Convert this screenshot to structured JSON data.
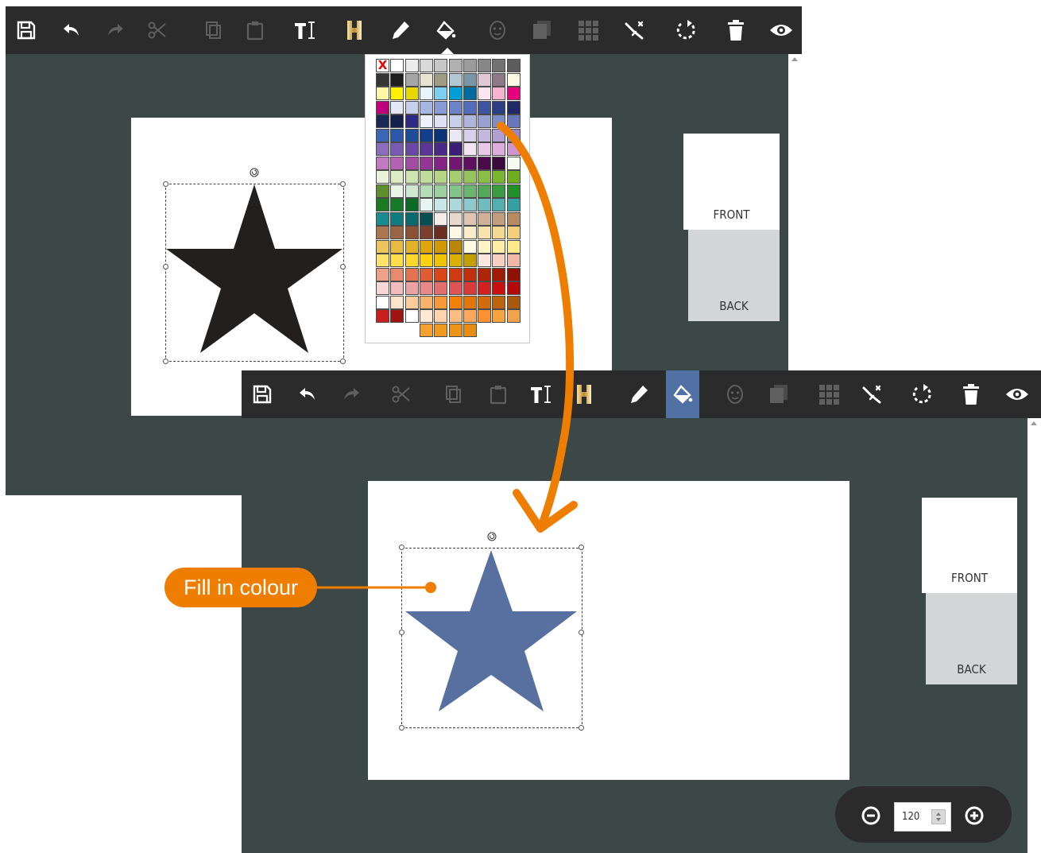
{
  "toolbar": {
    "tools": [
      {
        "name": "save-icon",
        "enabled": true
      },
      {
        "name": "undo-icon",
        "enabled": true
      },
      {
        "name": "redo-icon",
        "enabled": false
      },
      {
        "name": "cut-icon",
        "enabled": false
      },
      {
        "name": "copy-icon",
        "enabled": false
      },
      {
        "name": "paste-icon",
        "enabled": false
      },
      {
        "name": "add-text-icon",
        "enabled": true
      },
      {
        "name": "gold-foil-icon",
        "enabled": true
      },
      {
        "name": "pen-icon",
        "enabled": true
      },
      {
        "name": "fill-bucket-icon",
        "enabled": true
      },
      {
        "name": "face-mask-icon",
        "enabled": false
      },
      {
        "name": "layers-icon",
        "enabled": false
      },
      {
        "name": "grid-icon",
        "enabled": false
      },
      {
        "name": "magic-wand-icon",
        "enabled": true
      },
      {
        "name": "rotate-icon",
        "enabled": true
      },
      {
        "name": "trash-icon",
        "enabled": true
      },
      {
        "name": "preview-eye-icon",
        "enabled": true
      }
    ]
  },
  "pages": {
    "front_label": "FRONT",
    "back_label": "BACK"
  },
  "palette": {
    "no_colour_label": "X",
    "rows": [
      [
        "X",
        "#ffffff",
        "#ececec",
        "#d9d9d9",
        "#c6c6c6",
        "#b0b0b0",
        "#9b9b9b",
        "#878787",
        "#727272",
        "#5d5d5d"
      ],
      [
        "#353535",
        "#1e1e1e",
        "#a6a6a6",
        "#e8e4d0",
        "#9e9c83",
        "#b3c7d3",
        "#7a96a6",
        "#e0c8d6",
        "#8c7a86",
        "#fbf8e3"
      ],
      [
        "#fff7a8",
        "#fff200",
        "#e6d800",
        "#e8f4fc",
        "#7dcff0",
        "#00a0d7",
        "#006b9e",
        "#fde6f0",
        "#f5b3d0",
        "#e6007e"
      ],
      [
        "#c0007a",
        "#e3e8f6",
        "#c6d0ec",
        "#a7b6e0",
        "#8a9bd4",
        "#6e83c8",
        "#536cbc",
        "#3f55a0",
        "#2d3f84",
        "#1e2b68"
      ],
      [
        "#1a2a55",
        "#14214a",
        "#2e2a83",
        "#eef0fa",
        "#dfe2f4",
        "#c8cde9",
        "#aeb6de",
        "#97a2d3",
        "#7f8dc7",
        "#6678bb"
      ],
      [
        "#3a66b3",
        "#2b58a8",
        "#1f4b9a",
        "#123e8c",
        "#0b3478",
        "#ebe7f4",
        "#d8d0ea",
        "#c4b8df",
        "#af9fd3",
        "#9986c6"
      ],
      [
        "#8a6fbd",
        "#7a5bb2",
        "#6a48a5",
        "#5a3797",
        "#4a2988",
        "#3b1e77",
        "#f3e4f3",
        "#e7c9e7",
        "#dbaedb",
        "#cf93cf"
      ],
      [
        "#c27bc2",
        "#b463b4",
        "#a44ba4",
        "#943694",
        "#842484",
        "#731573",
        "#5f0f5f",
        "#4b0a4b",
        "#3a0a3a",
        "#f7fbef"
      ],
      [
        "#e9f3da",
        "#dcecc5",
        "#cfe5b0",
        "#c2dd9b",
        "#b4d585",
        "#a6cd70",
        "#98c55b",
        "#8abd46",
        "#7cb532",
        "#6ead1e"
      ],
      [
        "#5f8f2d",
        "#e8f5e8",
        "#cfe8d0",
        "#b6dbb8",
        "#9ccea0",
        "#83c288",
        "#6ab670",
        "#52a958",
        "#3a9d41",
        "#22902a"
      ],
      [
        "#1c7a23",
        "#157a2a",
        "#0b6a23",
        "#e6f4f4",
        "#c9e6e7",
        "#abd8d9",
        "#8ecacc",
        "#70bcbe",
        "#53aeb0",
        "#35a0a3"
      ],
      [
        "#198c90",
        "#0f7c80",
        "#0a6b6e",
        "#074e50",
        "#f4ece6",
        "#e8d8cc",
        "#dcc5b2",
        "#d0b198",
        "#c39e7e",
        "#b78a64"
      ],
      [
        "#ab7750",
        "#9b6444",
        "#8b5238",
        "#7b402d",
        "#6b2f22",
        "#fdf6e4",
        "#fbedc9",
        "#f8e3ae",
        "#f5d993",
        "#f2cf78"
      ],
      [
        "#eec55d",
        "#e9bb42",
        "#e4b127",
        "#dfa70c",
        "#d19a05",
        "#b88608",
        "#fffbe3",
        "#fff5c5",
        "#ffefa6",
        "#ffe988"
      ],
      [
        "#ffe36a",
        "#ffdd4b",
        "#ffd72d",
        "#ffd10f",
        "#f0c300",
        "#d9b000",
        "#c49f00",
        "#fbe6e0",
        "#f7cfc3",
        "#f2b8a7"
      ],
      [
        "#eda18a",
        "#e98a6e",
        "#e47351",
        "#df5c35",
        "#da4519",
        "#cf3a10",
        "#c0300c",
        "#b02508",
        "#a01b05",
        "#901103"
      ],
      [
        "#f7d6d6",
        "#f2bcbc",
        "#eda2a2",
        "#e88888",
        "#e36e6e",
        "#de5454",
        "#d93a3a",
        "#d42020",
        "#c81010",
        "#b40909"
      ],
      [
        "#ffffff",
        "#fde4cc",
        "#fbcb9b",
        "#f9b26a",
        "#f79939",
        "#f58008",
        "#e3760a",
        "#d06c0b",
        "#bd620d",
        "#aa580e"
      ],
      [
        "#c81e1e",
        "#a01414",
        "#ffffff",
        "#ffe9d6",
        "#ffd3ad",
        "#ffbd84",
        "#ffa75b",
        "#ff9132",
        "#f6a340",
        "#f1a24a"
      ],
      [
        "",
        "",
        "",
        "#f5a030",
        "#f19a20",
        "#ed9318",
        "#e98c12",
        "",
        "",
        ""
      ]
    ]
  },
  "zoom": {
    "value": "120"
  },
  "annotation": {
    "callout_text": "Fill in colour",
    "accent_color": "#ef7d00"
  },
  "colors": {
    "star_before": "#231f1f",
    "star_after": "#5870a0",
    "workspace": "#3b4847",
    "toolbar": "#2b2b2b",
    "active_tool": "#5170a4"
  }
}
